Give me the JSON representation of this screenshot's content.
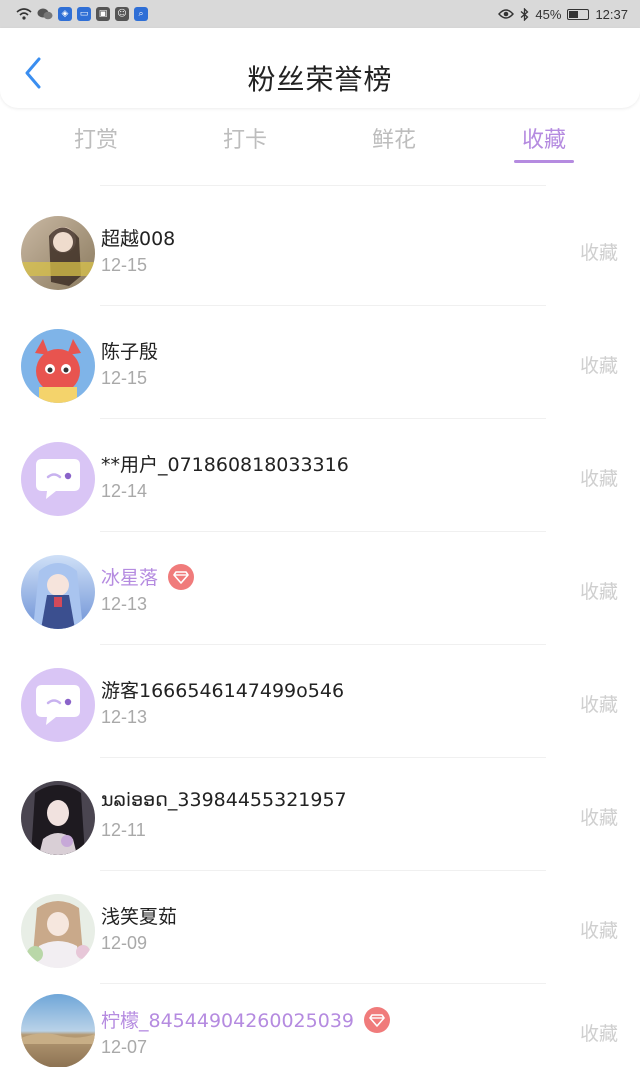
{
  "status_bar": {
    "battery": "45%",
    "time": "12:37",
    "icons": [
      "wifi-icon",
      "wechat-icon",
      "app-icon",
      "app-icon",
      "app-icon",
      "search-app-icon",
      "eye-icon",
      "bluetooth-icon",
      "battery-icon"
    ]
  },
  "header": {
    "title": "粉丝荣誉榜",
    "back_icon": "chevron-left-icon"
  },
  "tabs": [
    {
      "label": "打赏",
      "active": false
    },
    {
      "label": "打卡",
      "active": false
    },
    {
      "label": "鲜花",
      "active": false
    },
    {
      "label": "收藏",
      "active": true
    }
  ],
  "colors": {
    "accent": "#b58be0",
    "vip_badge": "#f07b7b",
    "muted": "#a9a9a9",
    "action": "#cfcfcf"
  },
  "fans": [
    {
      "name": "超越008",
      "date": "12-15",
      "action": "收藏",
      "vip": false,
      "avatar": "photo-avatar"
    },
    {
      "name": "陈子殷",
      "date": "12-15",
      "action": "收藏",
      "vip": false,
      "avatar": "dragon-avatar"
    },
    {
      "name": "**用户_071860818033316",
      "date": "12-14",
      "action": "收藏",
      "vip": false,
      "avatar": "default-chat-avatar"
    },
    {
      "name": "冰星落",
      "date": "12-13",
      "action": "收藏",
      "vip": true,
      "avatar": "anime-avatar"
    },
    {
      "name": "游客1666546147499o546",
      "date": "12-13",
      "action": "收藏",
      "vip": false,
      "avatar": "default-chat-avatar"
    },
    {
      "name": "ນລiອອດ_33984455321957",
      "date": "12-11",
      "action": "收藏",
      "vip": false,
      "avatar": "photo-avatar"
    },
    {
      "name": "浅笑夏茹",
      "date": "12-09",
      "action": "收藏",
      "vip": false,
      "avatar": "photo-avatar"
    },
    {
      "name": "柠檬_84544904260025039",
      "date": "12-07",
      "action": "收藏",
      "vip": true,
      "avatar": "landscape-avatar"
    }
  ]
}
